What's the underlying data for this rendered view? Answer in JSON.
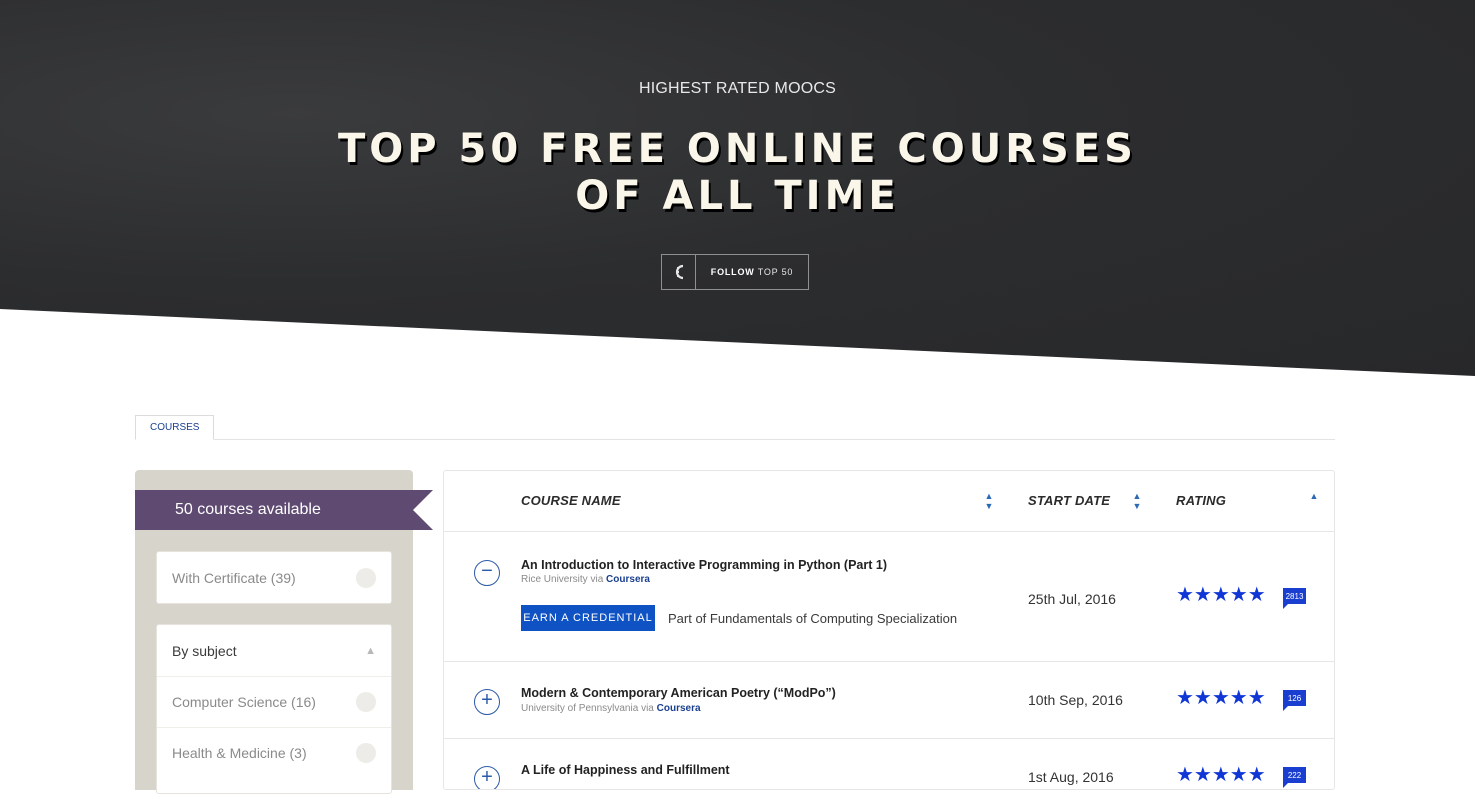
{
  "hero": {
    "kicker": "HIGHEST RATED MOOCS",
    "title_line1": "TOP 50 FREE ONLINE COURSES",
    "title_line2": "OF ALL TIME",
    "follow_icon": "class-central-logo-icon",
    "follow_bold": "FOLLOW",
    "follow_rest": " TOP 50"
  },
  "tabs": [
    {
      "label": "COURSES",
      "active": true
    }
  ],
  "sidebar": {
    "available": "50 courses available",
    "certificate": "With Certificate (39)",
    "subject_header": "By subject",
    "subjects": [
      "Computer Science (16)",
      "Health & Medicine (3)"
    ]
  },
  "table": {
    "headers": {
      "name": "COURSE NAME",
      "start": "START DATE",
      "rating": "RATING"
    },
    "rows": [
      {
        "title": "An Introduction to Interactive Programming in Python (Part 1)",
        "university": "Rice University",
        "via": "via",
        "provider": "Coursera",
        "credential_label": "EARN A CREDENTIAL",
        "specialization": "Part of Fundamentals of Computing Specialization",
        "start": "25th Jul, 2016",
        "stars": "★★★★★",
        "reviews": "2813",
        "expanded": true
      },
      {
        "title": "Modern & Contemporary American Poetry (“ModPo”)",
        "university": "University of Pennsylvania",
        "via": "via",
        "provider": "Coursera",
        "start": "10th Sep, 2016",
        "stars": "★★★★★",
        "reviews": "126",
        "expanded": false
      },
      {
        "title": "A Life of Happiness and Fulfillment",
        "start": "1st Aug, 2016",
        "stars": "★★★★★",
        "reviews": "222",
        "expanded": false
      }
    ]
  },
  "colors": {
    "ribbon": "#5f4a72",
    "accent_blue": "#0f52c4",
    "star_blue": "#1037d6",
    "link_blue": "#1b3f8f"
  }
}
